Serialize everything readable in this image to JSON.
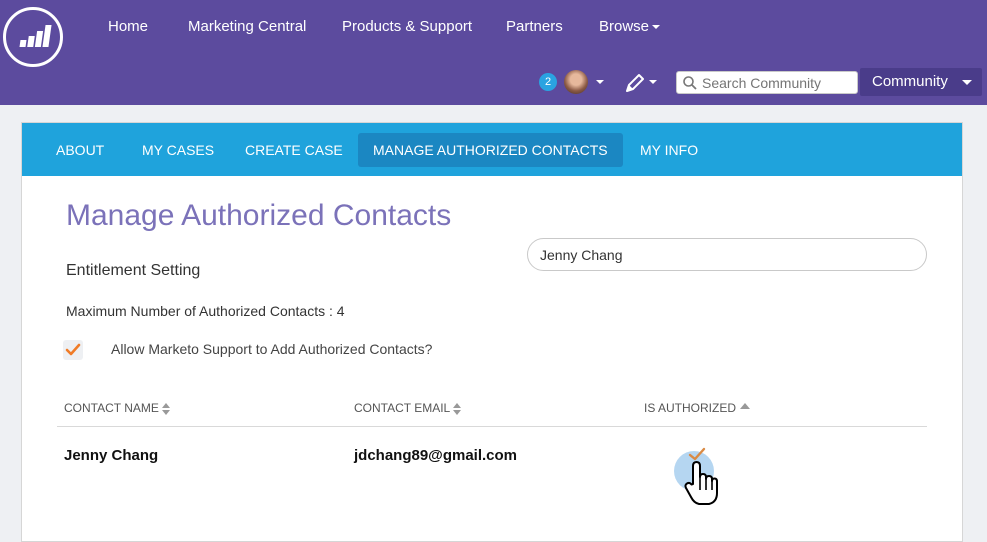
{
  "topbar": {
    "nav": [
      "Home",
      "Marketing Central",
      "Products & Support",
      "Partners",
      "Browse"
    ],
    "notifications_count": "2",
    "search_placeholder": "Search Community",
    "community_label": "Community"
  },
  "breadcrumb": "My Cases",
  "tabs": [
    "ABOUT",
    "MY CASES",
    "CREATE CASE",
    "MANAGE AUTHORIZED CONTACTS",
    "MY INFO"
  ],
  "active_tab": "MANAGE AUTHORIZED CONTACTS",
  "page": {
    "title": "Manage Authorized Contacts",
    "section": "Entitlement Setting",
    "max_contacts_text": "Maximum Number of Authorized Contacts : 4",
    "allow_support_label": "Allow Marketo Support to Add Authorized Contacts?",
    "allow_support_checked": true,
    "contact_search_value": "Jenny Chang"
  },
  "table": {
    "headers": [
      "CONTACT NAME",
      "CONTACT EMAIL",
      "IS AUTHORIZED"
    ],
    "rows": [
      {
        "name": "Jenny Chang",
        "email": "jdchang89@gmail.com",
        "authorized": true
      }
    ]
  },
  "colors": {
    "brand_purple": "#5c4b9e",
    "tab_blue": "#1fa3dc",
    "title_purple": "#7b72b9",
    "check_orange": "#f07c28"
  }
}
